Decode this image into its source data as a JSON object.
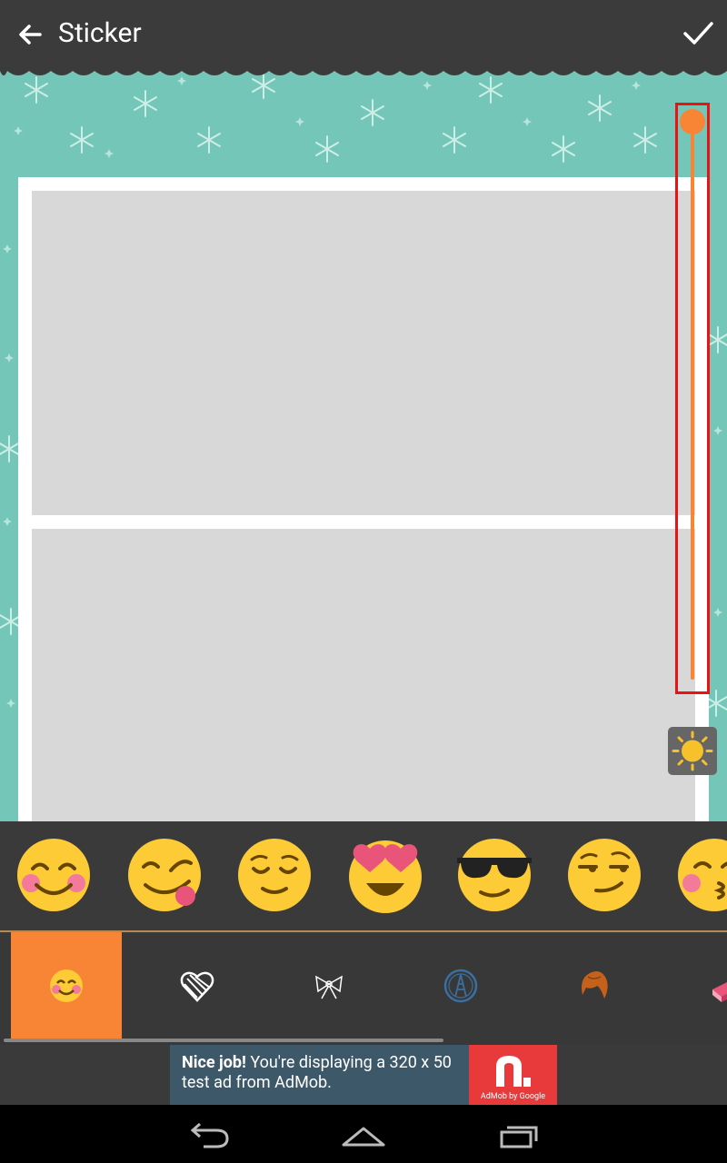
{
  "app_bar": {
    "title": "Sticker",
    "back_icon": "arrow-back-icon",
    "confirm_icon": "checkmark-icon"
  },
  "canvas": {
    "background": "teal snowflake pattern",
    "background_color": "#74c7b8",
    "photo_slots": 2
  },
  "size_slider": {
    "level": 1.0,
    "color": "#f78535",
    "highlight_color": "#ee1111"
  },
  "brightness_button": {
    "icon": "sun-icon"
  },
  "stickers": [
    {
      "name": "smiling-face-blushing-emoji"
    },
    {
      "name": "face-savoring-food-emoji"
    },
    {
      "name": "relieved-face-emoji"
    },
    {
      "name": "heart-eyes-emoji"
    },
    {
      "name": "sunglasses-face-emoji"
    },
    {
      "name": "smirking-face-emoji"
    },
    {
      "name": "kissing-face-emoji"
    }
  ],
  "categories": [
    {
      "name": "emoji",
      "icon": "smiley-icon",
      "active": true
    },
    {
      "name": "hearts",
      "icon": "scribble-heart-icon",
      "active": false
    },
    {
      "name": "bows",
      "icon": "bow-icon",
      "active": false
    },
    {
      "name": "stamps",
      "icon": "eiffel-stamp-icon",
      "active": false
    },
    {
      "name": "hair",
      "icon": "wig-icon",
      "active": false
    },
    {
      "name": "cake",
      "icon": "cake-icon",
      "active": false
    }
  ],
  "ad": {
    "headline": "Nice job!",
    "body": " You're displaying a 320 x 50 test ad from AdMob.",
    "brand": "AdMob by Google"
  },
  "system_nav": {
    "back": "nav-back-icon",
    "home": "nav-home-icon",
    "recents": "nav-recents-icon"
  },
  "colors": {
    "accent": "#f78535",
    "toolbar": "#3b3b3b",
    "ad_red": "#e83a3a"
  }
}
